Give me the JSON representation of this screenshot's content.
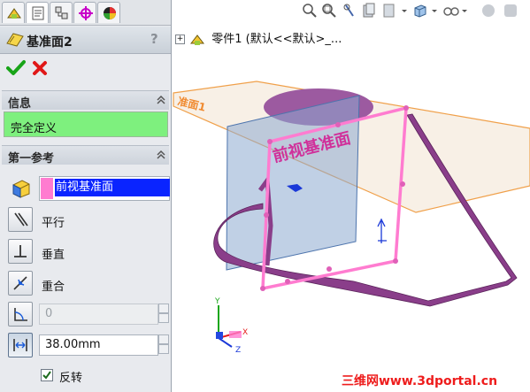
{
  "property_manager": {
    "title": "基准面2",
    "help": "?",
    "ok": "✔",
    "cancel": "✖",
    "message": {
      "header": "信息",
      "status": "完全定义"
    },
    "first_reference": {
      "header": "第一参考",
      "selection": "前视基准面",
      "options": [
        {
          "label": "平行"
        },
        {
          "label": "垂直"
        },
        {
          "label": "重合"
        }
      ],
      "angle_value": "0",
      "distance_value": "38.00mm",
      "flip_label": "反转",
      "flip_checked": true
    }
  },
  "feature_tree": {
    "expand": "+",
    "label": "零件1  (默认<<默认>_..."
  },
  "viewport": {
    "plane_label_front": "前视基准面",
    "plane_label_top": "准面1"
  },
  "watermark": "三维网www.3dportal.cn",
  "colors": {
    "status_green": "#7EF07E",
    "selection_blue": "#0A24FF",
    "reference_pink": "#FF7CD0",
    "model_purple": "#8A3E8A",
    "watermark_red": "#EE1C1C"
  },
  "icons": [
    "part-icon",
    "property-manager-icon",
    "config-icon",
    "origin-icon",
    "appearance-icon",
    "zoom-icon",
    "section-view-icon",
    "view-orientation-icon",
    "display-style-icon",
    "hide-show-icon",
    "scene-icon"
  ]
}
